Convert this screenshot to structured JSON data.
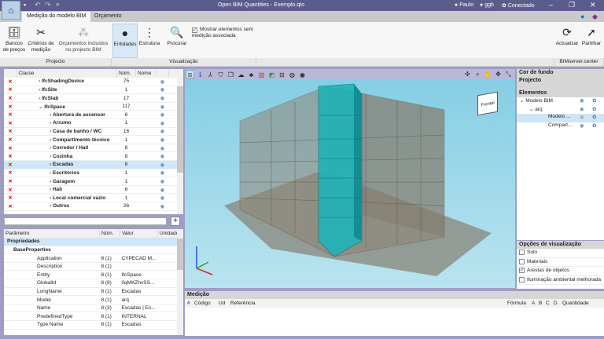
{
  "window": {
    "title": "Open BIM Quantities - Exemplo.qto",
    "users": [
      "Paulo",
      "ggb"
    ],
    "status": "Conectado"
  },
  "tabs": [
    "Medição do modelo BIM",
    "Orçamento"
  ],
  "ribbon": {
    "projecto": {
      "label": "Projecto",
      "buttons": [
        "Bancos\nde preços",
        "Critérios de\nmedição",
        "Orçamentos incluídos\nno projecto BIM"
      ]
    },
    "visualizacao": {
      "label": "Visualização",
      "buttons": [
        "Entidades",
        "Estrutura",
        "Procurar"
      ],
      "checkbox": "Mostrar elementos sem medição associada"
    },
    "bimserver": {
      "label": "BIMserver.center",
      "buttons": [
        "Actualizar",
        "Partilhar"
      ]
    }
  },
  "tree": {
    "columns": [
      "Classe",
      "Núm.",
      "Nome"
    ],
    "rows": [
      {
        "name": "IfcShadingDevice",
        "num": "75",
        "level": 1,
        "open": false
      },
      {
        "name": "IfcSite",
        "num": "1",
        "level": 1,
        "open": false
      },
      {
        "name": "IfcSlab",
        "num": "17",
        "level": 1,
        "open": false
      },
      {
        "name": "IfcSpace",
        "num": "117",
        "level": 1,
        "open": true
      },
      {
        "name": "Abertura de ascensor",
        "num": "6",
        "level": 2
      },
      {
        "name": "Arrumo",
        "num": "1",
        "level": 2
      },
      {
        "name": "Casa de banho / WC",
        "num": "16",
        "level": 2
      },
      {
        "name": "Compartimento técnico",
        "num": "1",
        "level": 2
      },
      {
        "name": "Corredor / Hall",
        "num": "8",
        "level": 2
      },
      {
        "name": "Cozinha",
        "num": "8",
        "level": 2
      },
      {
        "name": "Escadas",
        "num": "8",
        "level": 2,
        "selected": true
      },
      {
        "name": "Escritórios",
        "num": "1",
        "level": 2
      },
      {
        "name": "Garagem",
        "num": "1",
        "level": 2
      },
      {
        "name": "Hall",
        "num": "6",
        "level": 2
      },
      {
        "name": "Local comercial vazio",
        "num": "1",
        "level": 2
      },
      {
        "name": "Outros",
        "num": "26",
        "level": 2
      }
    ]
  },
  "search": {
    "value": "",
    "add": "+"
  },
  "params": {
    "columns": [
      "Parâmetro",
      "Núm.",
      "Valor",
      "Unidade"
    ],
    "groups": [
      "Propriedades",
      "BaseProperties"
    ],
    "rows": [
      {
        "name": "Application",
        "num": "8 (1)",
        "value": "CYPECAD M..."
      },
      {
        "name": "Description",
        "num": "8 (1)",
        "value": ""
      },
      {
        "name": "Entity",
        "num": "8 (1)",
        "value": "IfcSpace"
      },
      {
        "name": "GlobalId",
        "num": "8 (8)",
        "value": "0qMKZhvSS..."
      },
      {
        "name": "LongName",
        "num": "8 (1)",
        "value": "Escadas"
      },
      {
        "name": "Model",
        "num": "8 (1)",
        "value": "arq"
      },
      {
        "name": "Name",
        "num": "8 (3)",
        "value": "Escadas | Es..."
      },
      {
        "name": "PredefinedType",
        "num": "8 (1)",
        "value": "INTERNAL"
      },
      {
        "name": "Type Name",
        "num": "8 (1)",
        "value": "Escadas"
      }
    ]
  },
  "viewcube": {
    "label": "Frontal"
  },
  "right": {
    "sections": [
      "Cor de fundo",
      "Projecto",
      "Elementos"
    ],
    "elements": [
      {
        "name": "Modelo BIM",
        "level": 0
      },
      {
        "name": "arq",
        "level": 1
      },
      {
        "name": "Modelo ...",
        "level": 2,
        "selected": true,
        "hidden": true
      },
      {
        "name": "Compart...",
        "level": 2
      }
    ],
    "options_title": "Opções de visualização",
    "options": [
      {
        "label": "Solo",
        "checked": false
      },
      {
        "label": "Materiais",
        "checked": false
      },
      {
        "label": "Arestas de objetos",
        "checked": true
      },
      {
        "label": "Iluminação ambiental melhorada",
        "checked": false
      }
    ]
  },
  "medicao": {
    "title": "Medição",
    "columns": [
      "#",
      "Código",
      "Ud",
      "Referência",
      "Fórmula",
      "A",
      "B",
      "C",
      "D",
      "Quantidade"
    ]
  },
  "colors": {
    "titlebar": "#5b5b8c",
    "background": "#9d9dc6",
    "viewport": "#8fd3e6",
    "teal": "#1fb3b8",
    "selection": "#cfe6f8"
  }
}
